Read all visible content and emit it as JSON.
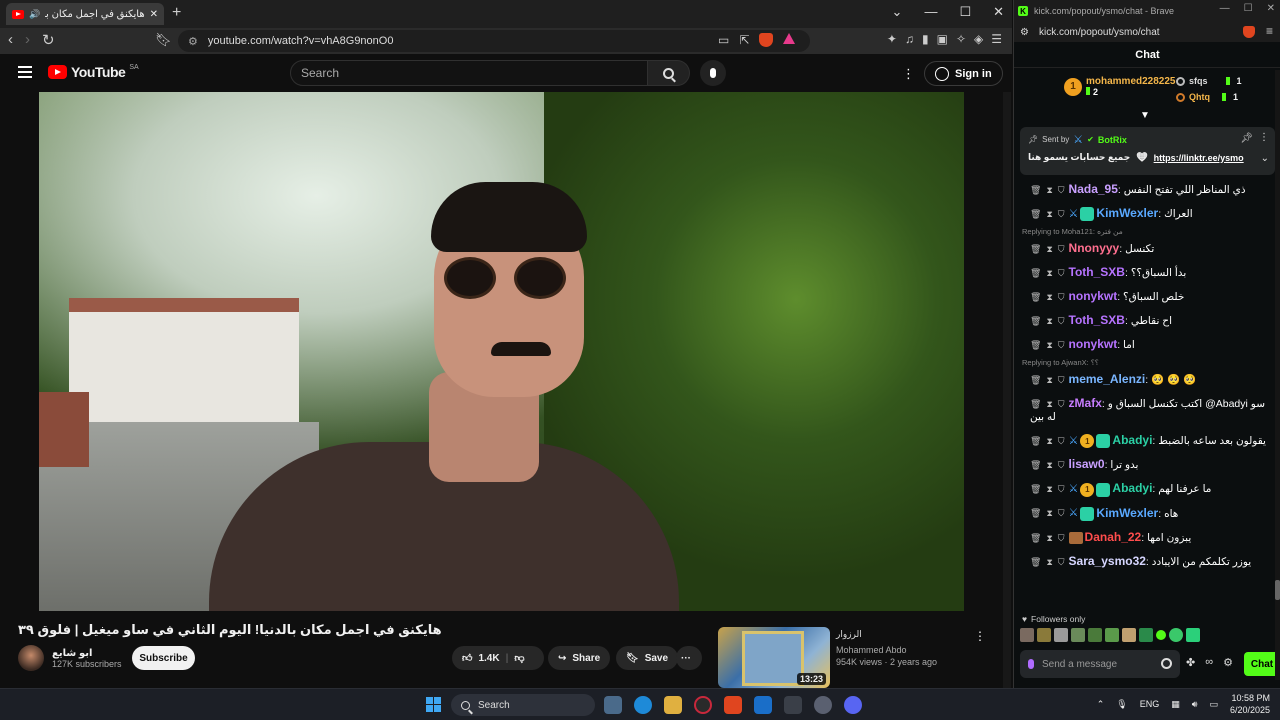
{
  "browser_left": {
    "tab_title": "هايكنق في اجمل مكان بالدنيا! اليوم",
    "url": "youtube.com/watch?v=vhA8G9nonO0",
    "new_tab": "+",
    "window_controls": [
      "⌄",
      "—",
      "☐",
      "✕"
    ]
  },
  "youtube": {
    "logo_text": "YouTube",
    "country_code": "SA",
    "search_placeholder": "Search",
    "sign_in": "Sign in",
    "video_title": "هايكنق في اجمل مكان بالدنيا! اليوم الثاني في ساو ميغيل | فلوق ٣٩",
    "channel_name": "ابو شايع",
    "subscribers": "127K subscribers",
    "subscribe": "Subscribe",
    "likes": "1.4K",
    "share": "Share",
    "save": "Save",
    "more": "···",
    "related": {
      "title": "الرزوار",
      "channel": "Mohammed Abdo",
      "meta": "954K views · 2 years ago",
      "duration": "13:23"
    }
  },
  "chat_window": {
    "url_title": "kick.com/popout/ysmo/chat - Brave",
    "url": "kick.com/popout/ysmo/chat",
    "header": "Chat",
    "leaderboard": {
      "top_name": "mohammed228225",
      "top_count": "2",
      "medal": "1",
      "side": [
        {
          "name": "sfqs",
          "count": "1"
        },
        {
          "name": "Qhtq",
          "count": "1"
        }
      ]
    },
    "pinned": {
      "sent_by_label": "Sent by",
      "bot_name": "BotRix",
      "message": "جميع حسابات يسمو هنا",
      "link": "https://linktr.ee/ysmo"
    },
    "messages": [
      {
        "user": "Nada_95",
        "color": "#c9a0ff",
        "text": "ذي المناظر اللي تفتح النفس",
        "badges": []
      },
      {
        "user": "KimWexler",
        "color": "#5aa9ff",
        "text": "العراك",
        "badges": [
          "sword",
          "gift"
        ]
      },
      {
        "reply": "Replying to Moha121: من فتره"
      },
      {
        "user": "Nnonyyy",
        "color": "#ff6f8f",
        "text": "تكنسل",
        "badges": []
      },
      {
        "user": "Toth_SXB",
        "color": "#b673ff",
        "text": "بدأ السباق؟؟",
        "badges": []
      },
      {
        "user": "nonykwt",
        "color": "#b673ff",
        "text": "خلص السباق؟",
        "badges": []
      },
      {
        "user": "Toth_SXB",
        "color": "#b673ff",
        "text": "اح نقاطي",
        "badges": []
      },
      {
        "user": "nonykwt",
        "color": "#b673ff",
        "text": "اما",
        "badges": []
      },
      {
        "reply": "Replying to AjwanX: ؟؟"
      },
      {
        "user": "meme_Alenzi",
        "color": "#7ab6ff",
        "text": "🥺 🥺 🥺",
        "badges": []
      },
      {
        "user": "zMafx",
        "color": "#c77dff",
        "text": "اكتب تكنسل السباق و @Abadyi سو له بين",
        "badges": []
      },
      {
        "user": "Abadyi",
        "color": "#2bd0a5",
        "text": "يقولون بعد ساعه بالضبط",
        "badges": [
          "sword",
          "coin",
          "gift"
        ]
      },
      {
        "user": "lisaw0",
        "color": "#c9a0ff",
        "text": "بدو ترا",
        "badges": []
      },
      {
        "user": "Abadyi",
        "color": "#2bd0a5",
        "text": "ما عرفنا لهم",
        "badges": [
          "sword",
          "coin",
          "gift"
        ]
      },
      {
        "user": "KimWexler",
        "color": "#5aa9ff",
        "text": "هاه",
        "badges": [
          "sword",
          "gift"
        ]
      },
      {
        "user": "Danah_22",
        "color": "#ff4d4d",
        "text": "يبزون امها",
        "badges": [
          "emote"
        ]
      },
      {
        "user": "Sara_ysmo32",
        "color": "#d6d6ff",
        "text": "يوزر تكلمكم من الايبادد",
        "badges": []
      }
    ],
    "followers_only": "Followers only",
    "input_placeholder": "Send a message",
    "send": "Chat"
  },
  "taskbar": {
    "search": "Search",
    "lang": "ENG",
    "time": "10:58 PM",
    "date": "6/20/2025"
  },
  "colors": {
    "kick_green": "#53fc18",
    "youtube_red": "#ff0000"
  }
}
